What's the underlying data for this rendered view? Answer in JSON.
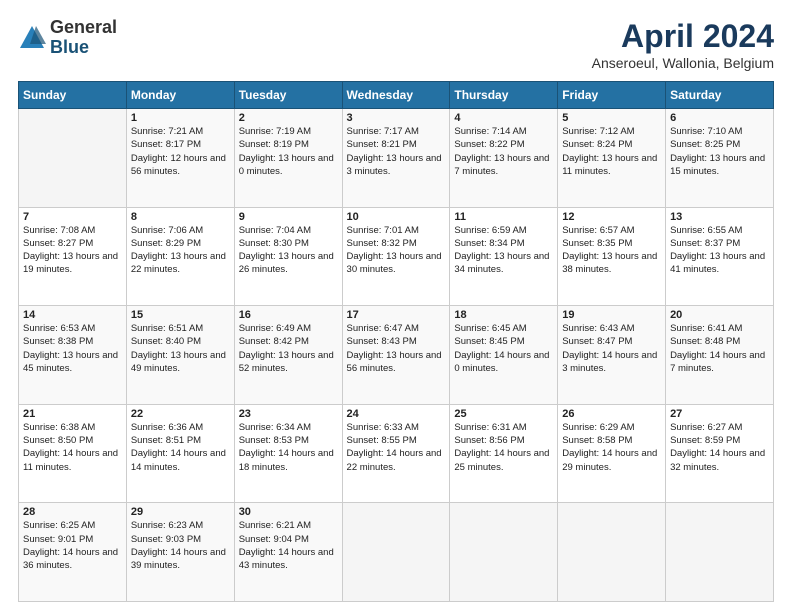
{
  "logo": {
    "general": "General",
    "blue": "Blue"
  },
  "header": {
    "title": "April 2024",
    "subtitle": "Anseroeul, Wallonia, Belgium"
  },
  "weekdays": [
    "Sunday",
    "Monday",
    "Tuesday",
    "Wednesday",
    "Thursday",
    "Friday",
    "Saturday"
  ],
  "weeks": [
    [
      {
        "day": "",
        "sunrise": "",
        "sunset": "",
        "daylight": ""
      },
      {
        "day": "1",
        "sunrise": "Sunrise: 7:21 AM",
        "sunset": "Sunset: 8:17 PM",
        "daylight": "Daylight: 12 hours and 56 minutes."
      },
      {
        "day": "2",
        "sunrise": "Sunrise: 7:19 AM",
        "sunset": "Sunset: 8:19 PM",
        "daylight": "Daylight: 13 hours and 0 minutes."
      },
      {
        "day": "3",
        "sunrise": "Sunrise: 7:17 AM",
        "sunset": "Sunset: 8:21 PM",
        "daylight": "Daylight: 13 hours and 3 minutes."
      },
      {
        "day": "4",
        "sunrise": "Sunrise: 7:14 AM",
        "sunset": "Sunset: 8:22 PM",
        "daylight": "Daylight: 13 hours and 7 minutes."
      },
      {
        "day": "5",
        "sunrise": "Sunrise: 7:12 AM",
        "sunset": "Sunset: 8:24 PM",
        "daylight": "Daylight: 13 hours and 11 minutes."
      },
      {
        "day": "6",
        "sunrise": "Sunrise: 7:10 AM",
        "sunset": "Sunset: 8:25 PM",
        "daylight": "Daylight: 13 hours and 15 minutes."
      }
    ],
    [
      {
        "day": "7",
        "sunrise": "Sunrise: 7:08 AM",
        "sunset": "Sunset: 8:27 PM",
        "daylight": "Daylight: 13 hours and 19 minutes."
      },
      {
        "day": "8",
        "sunrise": "Sunrise: 7:06 AM",
        "sunset": "Sunset: 8:29 PM",
        "daylight": "Daylight: 13 hours and 22 minutes."
      },
      {
        "day": "9",
        "sunrise": "Sunrise: 7:04 AM",
        "sunset": "Sunset: 8:30 PM",
        "daylight": "Daylight: 13 hours and 26 minutes."
      },
      {
        "day": "10",
        "sunrise": "Sunrise: 7:01 AM",
        "sunset": "Sunset: 8:32 PM",
        "daylight": "Daylight: 13 hours and 30 minutes."
      },
      {
        "day": "11",
        "sunrise": "Sunrise: 6:59 AM",
        "sunset": "Sunset: 8:34 PM",
        "daylight": "Daylight: 13 hours and 34 minutes."
      },
      {
        "day": "12",
        "sunrise": "Sunrise: 6:57 AM",
        "sunset": "Sunset: 8:35 PM",
        "daylight": "Daylight: 13 hours and 38 minutes."
      },
      {
        "day": "13",
        "sunrise": "Sunrise: 6:55 AM",
        "sunset": "Sunset: 8:37 PM",
        "daylight": "Daylight: 13 hours and 41 minutes."
      }
    ],
    [
      {
        "day": "14",
        "sunrise": "Sunrise: 6:53 AM",
        "sunset": "Sunset: 8:38 PM",
        "daylight": "Daylight: 13 hours and 45 minutes."
      },
      {
        "day": "15",
        "sunrise": "Sunrise: 6:51 AM",
        "sunset": "Sunset: 8:40 PM",
        "daylight": "Daylight: 13 hours and 49 minutes."
      },
      {
        "day": "16",
        "sunrise": "Sunrise: 6:49 AM",
        "sunset": "Sunset: 8:42 PM",
        "daylight": "Daylight: 13 hours and 52 minutes."
      },
      {
        "day": "17",
        "sunrise": "Sunrise: 6:47 AM",
        "sunset": "Sunset: 8:43 PM",
        "daylight": "Daylight: 13 hours and 56 minutes."
      },
      {
        "day": "18",
        "sunrise": "Sunrise: 6:45 AM",
        "sunset": "Sunset: 8:45 PM",
        "daylight": "Daylight: 14 hours and 0 minutes."
      },
      {
        "day": "19",
        "sunrise": "Sunrise: 6:43 AM",
        "sunset": "Sunset: 8:47 PM",
        "daylight": "Daylight: 14 hours and 3 minutes."
      },
      {
        "day": "20",
        "sunrise": "Sunrise: 6:41 AM",
        "sunset": "Sunset: 8:48 PM",
        "daylight": "Daylight: 14 hours and 7 minutes."
      }
    ],
    [
      {
        "day": "21",
        "sunrise": "Sunrise: 6:38 AM",
        "sunset": "Sunset: 8:50 PM",
        "daylight": "Daylight: 14 hours and 11 minutes."
      },
      {
        "day": "22",
        "sunrise": "Sunrise: 6:36 AM",
        "sunset": "Sunset: 8:51 PM",
        "daylight": "Daylight: 14 hours and 14 minutes."
      },
      {
        "day": "23",
        "sunrise": "Sunrise: 6:34 AM",
        "sunset": "Sunset: 8:53 PM",
        "daylight": "Daylight: 14 hours and 18 minutes."
      },
      {
        "day": "24",
        "sunrise": "Sunrise: 6:33 AM",
        "sunset": "Sunset: 8:55 PM",
        "daylight": "Daylight: 14 hours and 22 minutes."
      },
      {
        "day": "25",
        "sunrise": "Sunrise: 6:31 AM",
        "sunset": "Sunset: 8:56 PM",
        "daylight": "Daylight: 14 hours and 25 minutes."
      },
      {
        "day": "26",
        "sunrise": "Sunrise: 6:29 AM",
        "sunset": "Sunset: 8:58 PM",
        "daylight": "Daylight: 14 hours and 29 minutes."
      },
      {
        "day": "27",
        "sunrise": "Sunrise: 6:27 AM",
        "sunset": "Sunset: 8:59 PM",
        "daylight": "Daylight: 14 hours and 32 minutes."
      }
    ],
    [
      {
        "day": "28",
        "sunrise": "Sunrise: 6:25 AM",
        "sunset": "Sunset: 9:01 PM",
        "daylight": "Daylight: 14 hours and 36 minutes."
      },
      {
        "day": "29",
        "sunrise": "Sunrise: 6:23 AM",
        "sunset": "Sunset: 9:03 PM",
        "daylight": "Daylight: 14 hours and 39 minutes."
      },
      {
        "day": "30",
        "sunrise": "Sunrise: 6:21 AM",
        "sunset": "Sunset: 9:04 PM",
        "daylight": "Daylight: 14 hours and 43 minutes."
      },
      {
        "day": "",
        "sunrise": "",
        "sunset": "",
        "daylight": ""
      },
      {
        "day": "",
        "sunrise": "",
        "sunset": "",
        "daylight": ""
      },
      {
        "day": "",
        "sunrise": "",
        "sunset": "",
        "daylight": ""
      },
      {
        "day": "",
        "sunrise": "",
        "sunset": "",
        "daylight": ""
      }
    ]
  ]
}
